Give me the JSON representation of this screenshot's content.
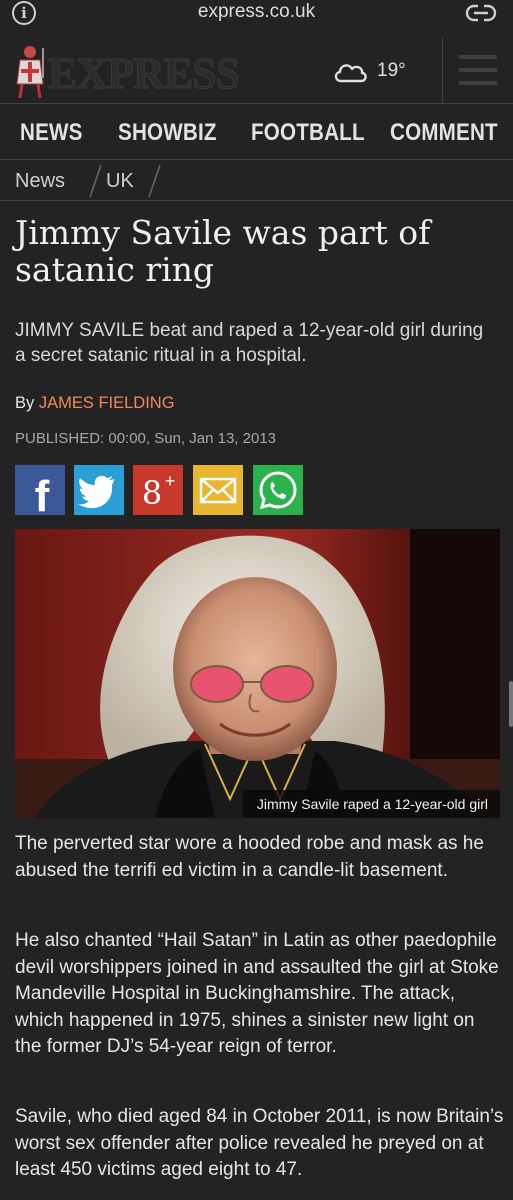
{
  "browser": {
    "url": "express.co.uk",
    "info_icon": "info-icon",
    "link_icon": "link-icon"
  },
  "header": {
    "logo_text": "EXPRESS",
    "weather_icon": "cloud-icon",
    "temperature": "19°",
    "menu_icon": "hamburger-menu-icon"
  },
  "nav": {
    "items": [
      "NEWS",
      "SHOWBIZ",
      "FOOTBALL",
      "COMMENT"
    ]
  },
  "breadcrumb": {
    "items": [
      "News",
      "UK"
    ]
  },
  "article": {
    "headline": "Jimmy Savile was part of satanic ring",
    "standfirst": "JIMMY SAVILE beat and raped a 12-year-old girl during a secret satanic ritual in a hospital.",
    "byline_prefix": "By",
    "author": "JAMES FIELDING",
    "published": "PUBLISHED: 00:00, Sun, Jan 13, 2013",
    "image_caption": "Jimmy Savile raped a 12-year-old girl",
    "paragraphs": [
      "The perverted star wore a hooded robe and mask as he abused the terrifi ed victim in a candle-lit basement.",
      "He also chanted “Hail Satan” in Latin as other paedophile devil worshippers joined in and assaulted the girl at Stoke Mandeville Hospital in Buckinghamshire. The attack, which happened in 1975, shines a sinister new light on the former DJ’s 54-year reign of terror.",
      "Savile, who died aged 84 in October 2011, is now Britain’s worst sex offender after police revealed he preyed on at least 450 victims aged eight to 47."
    ]
  },
  "share": {
    "buttons": [
      {
        "name": "facebook",
        "glyph": "f",
        "color": "#3b5998"
      },
      {
        "name": "twitter",
        "glyph": "",
        "color": "#2a9fd6"
      },
      {
        "name": "google-plus",
        "glyph": "8+",
        "color": "#c7392b"
      },
      {
        "name": "email",
        "glyph": "",
        "color": "#e8b630"
      },
      {
        "name": "whatsapp",
        "glyph": "",
        "color": "#2bb24c"
      }
    ]
  },
  "colors": {
    "background": "#232323",
    "author": "#f08a5d",
    "divider": "#444444"
  }
}
